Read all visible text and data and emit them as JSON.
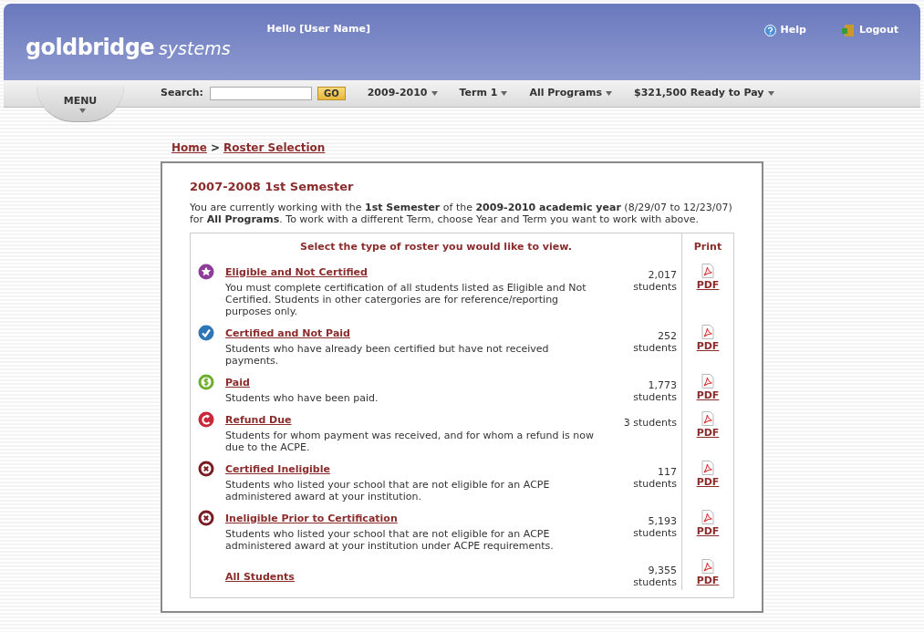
{
  "header": {
    "logo_main": "goldbridge",
    "logo_sub": "systems",
    "greeting": "Hello [User Name]",
    "help": "Help",
    "logout": "Logout"
  },
  "nav": {
    "menu": "MENU",
    "search_label": "Search:",
    "go": "GO",
    "dropdowns": [
      "2009-2010",
      "Term 1",
      "All Programs",
      "$321,500 Ready to Pay"
    ]
  },
  "breadcrumb": [
    "Home",
    "Roster Selection"
  ],
  "breadcrumb_separator": ">",
  "panel": {
    "title": "2007-2008 1st Semester",
    "intro": "You are currently working with the **1st Semester** of the **2009-2010 academic year** (8/29/07 to 12/23/07) for **All Programs**. To work with a different Term, choose Year and Term you want to work with above.",
    "table_heading": "Select the type of roster you would like to view.",
    "print_heading": "Print",
    "rows": [
      {
        "kind": "star",
        "title": "Eligible and Not Certified",
        "description": "You must complete certification of all students listed as Eligible and Not Certified. Students in other catergories are for reference/reporting purposes only.",
        "count": "2,017 students",
        "print": "PDF"
      },
      {
        "kind": "check",
        "title": "Certified and Not Paid",
        "description": "Students who have already been certified but have not received payments.",
        "count": "252 students",
        "print": "PDF"
      },
      {
        "kind": "dollar",
        "title": "Paid",
        "description": "Students who have been paid.",
        "count": "1,773 students",
        "print": "PDF"
      },
      {
        "kind": "refund",
        "title": "Refund Due",
        "description": "Students for whom payment was received, and for whom a refund is now due to the ACPE.",
        "count": "3 students",
        "print": "PDF"
      },
      {
        "kind": "cross",
        "title": "Certified Ineligible",
        "description": "Students who listed your school that are not eligible for an ACPE administered award at your institution.",
        "count": "117 students",
        "print": "PDF"
      },
      {
        "kind": "cross",
        "title": "Ineligible Prior to Certification",
        "description": "Students who listed your school that are not eligible for an ACPE administered award at your institution under ACPE requirements.",
        "count": "5,193 students",
        "print": "PDF"
      },
      {
        "kind": "none",
        "title": "All Students",
        "count": "9,355 students",
        "print": "PDF"
      }
    ]
  }
}
